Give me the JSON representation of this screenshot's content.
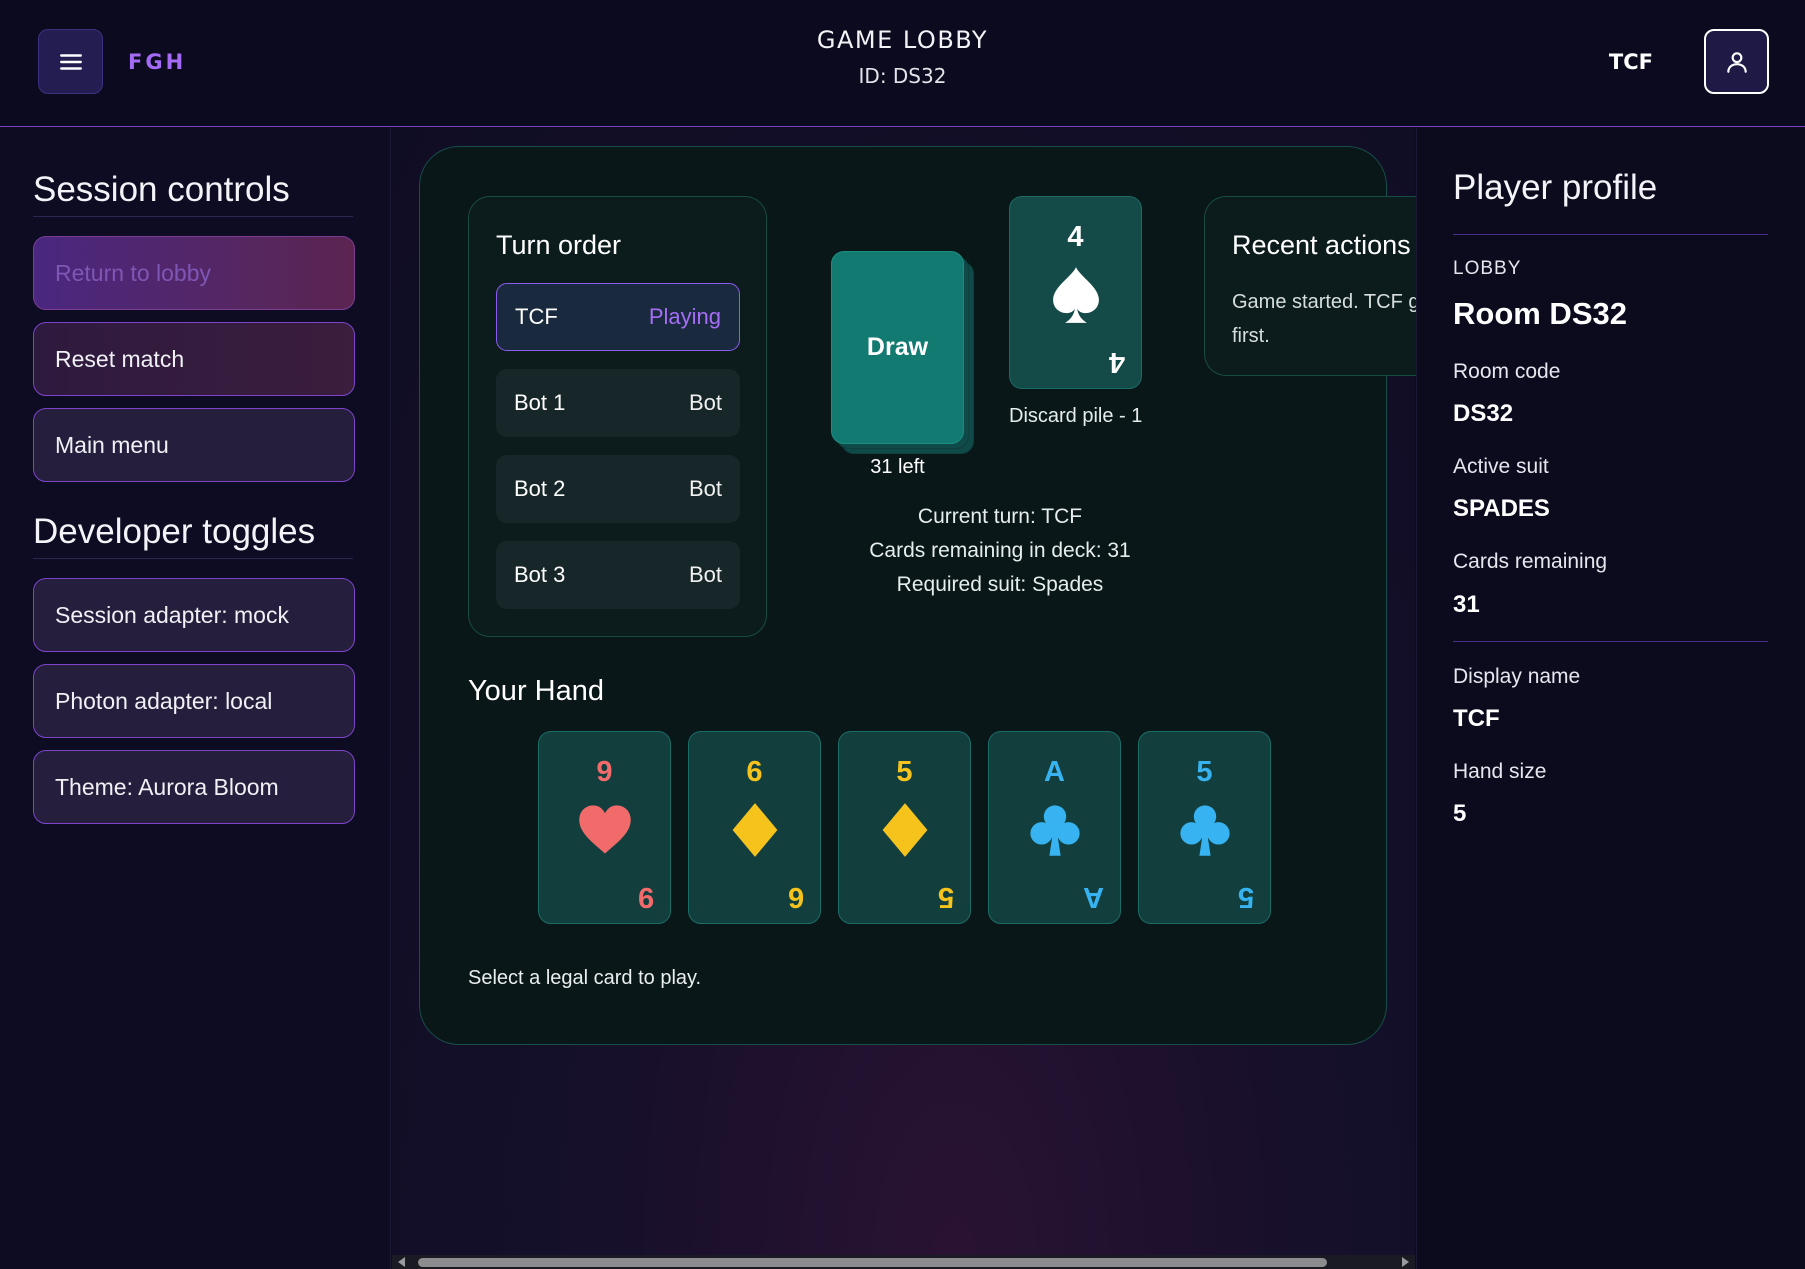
{
  "header": {
    "brand": "FGH",
    "title": "GAME LOBBY",
    "subtitle": "ID: DS32",
    "user_name": "TCF"
  },
  "left_panel": {
    "session_heading": "Session controls",
    "session_buttons": [
      {
        "label": "Return to lobby",
        "disabled": true
      },
      {
        "label": "Reset match"
      },
      {
        "label": "Main menu"
      }
    ],
    "dev_heading": "Developer toggles",
    "dev_buttons": [
      {
        "label": "Session adapter: mock"
      },
      {
        "label": "Photon adapter: local"
      },
      {
        "label": "Theme: Aurora Bloom"
      }
    ]
  },
  "board": {
    "turn_order": {
      "title": "Turn order",
      "players": [
        {
          "name": "TCF",
          "role": "Playing",
          "active": true
        },
        {
          "name": "Bot 1",
          "role": "Bot"
        },
        {
          "name": "Bot 2",
          "role": "Bot"
        },
        {
          "name": "Bot 3",
          "role": "Bot"
        }
      ]
    },
    "deck": {
      "draw_label": "Draw",
      "left_label": "31 left"
    },
    "discard": {
      "rank": "4",
      "suit": "spades",
      "color": "#ffffff",
      "label": "Discard pile - 1"
    },
    "recent_actions": {
      "title": "Recent actions",
      "text": "Game started. TCF goes first."
    },
    "status": {
      "current_turn": "Current turn: TCF",
      "cards_remaining": "Cards remaining in deck: 31",
      "required_suit": "Required suit: Spades"
    },
    "hand_title": "Your Hand",
    "hand": [
      {
        "rank": "9",
        "suit": "hearts",
        "color": "#f26b6b"
      },
      {
        "rank": "6",
        "suit": "diamonds",
        "color": "#f6c31c"
      },
      {
        "rank": "5",
        "suit": "diamonds",
        "color": "#f6c31c"
      },
      {
        "rank": "A",
        "suit": "clubs",
        "color": "#36b3f0"
      },
      {
        "rank": "5",
        "suit": "clubs",
        "color": "#36b3f0"
      }
    ],
    "hint": "Select a legal card to play."
  },
  "right_panel": {
    "title": "Player profile",
    "lobby_label": "LOBBY",
    "room_name": "Room DS32",
    "fields": [
      {
        "label": "Room code",
        "value": "DS32"
      },
      {
        "label": "Active suit",
        "value": "SPADES"
      },
      {
        "label": "Cards remaining",
        "value": "31"
      },
      {
        "label": "Display name",
        "value": "TCF"
      },
      {
        "label": "Hand size",
        "value": "5"
      }
    ]
  },
  "colors": {
    "accent": "#a36bf5",
    "board_bg": "#0a1718",
    "card_bg": "#123f3e",
    "draw_card": "#137a71"
  },
  "icons": {
    "menu": "hamburger-icon",
    "user": "user-icon"
  }
}
